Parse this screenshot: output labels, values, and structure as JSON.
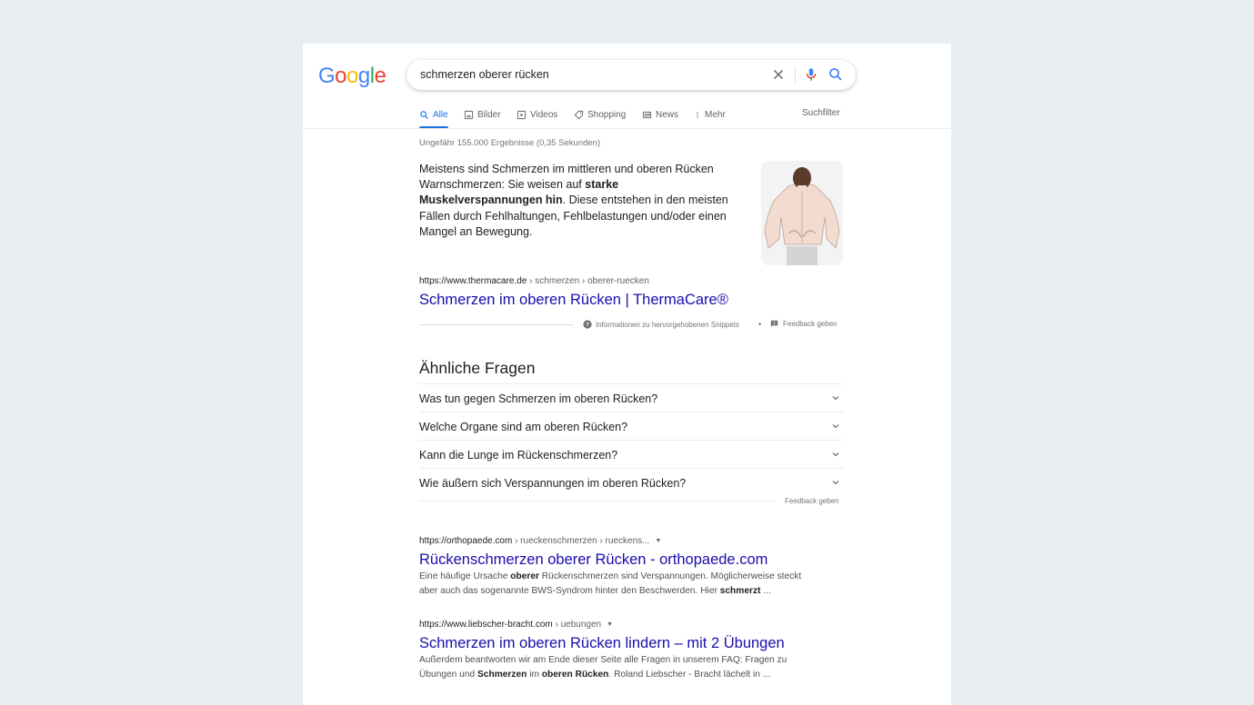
{
  "logo": {
    "letters": [
      "G",
      "o",
      "o",
      "g",
      "l",
      "e"
    ],
    "colors": [
      "#4285f4",
      "#ea4335",
      "#fbbc05",
      "#4285f4",
      "#34a853",
      "#ea4335"
    ]
  },
  "search": {
    "query": "schmerzen oberer rücken"
  },
  "tabs": [
    {
      "label": "Alle",
      "icon": "search-icon",
      "active": true
    },
    {
      "label": "Bilder",
      "icon": "image-icon"
    },
    {
      "label": "Videos",
      "icon": "video-icon"
    },
    {
      "label": "Shopping",
      "icon": "tag-icon"
    },
    {
      "label": "News",
      "icon": "news-icon"
    },
    {
      "label": "Mehr",
      "icon": "more-vert-icon"
    }
  ],
  "suchfilter": "Suchfilter",
  "stats": "Ungefähr 155.000 Ergebnisse (0,35 Sekunden)",
  "featured": {
    "text_1": "Meistens sind Schmerzen im mittleren und oberen Rücken Warnschmerzen: Sie weisen auf ",
    "text_bold": "starke Muskelverspannungen hin",
    "text_2": ". Diese entstehen in den meisten Fällen durch Fehlhaltungen, Fehlbelastungen und/oder einen Mangel an Bewegung.",
    "cite_domain": "https://www.thermacare.de",
    "cite_path": " › schmerzen › oberer-ruecken",
    "title": "Schmerzen im oberen Rücken | ThermaCare®",
    "info_label": "Informationen zu hervorgehobenen Snippets",
    "dot": "•",
    "feedback": "Feedback geben"
  },
  "paa": {
    "heading": "Ähnliche Fragen",
    "questions": [
      "Was tun gegen Schmerzen im oberen Rücken?",
      "Welche Organe sind am oberen Rücken?",
      "Kann die Lunge im Rückenschmerzen?",
      "Wie äußern sich Verspannungen im oberen Rücken?"
    ],
    "feedback": "Feedback geben"
  },
  "results": [
    {
      "cite_domain": "https://orthopaede.com",
      "cite_path": " › rueckenschmerzen › rueckens...",
      "title": "Rückenschmerzen oberer Rücken - orthopaede.com",
      "desc_parts": [
        {
          "t": "Eine häufige Ursache "
        },
        {
          "t": "oberer",
          "b": true
        },
        {
          "t": " Rückenschmerzen sind Verspannungen. Möglicherweise steckt aber auch das sogenannte BWS-Syndrom hinter den Beschwerden. Hier "
        },
        {
          "t": "schmerzt",
          "b": true
        },
        {
          "t": " ..."
        }
      ]
    },
    {
      "cite_domain": "https://www.liebscher-bracht.com",
      "cite_path": " › uebungen",
      "title": "Schmerzen im oberen Rücken lindern – mit 2 Übungen",
      "desc_parts": [
        {
          "t": "Außerdem beantworten wir am Ende dieser Seite alle Fragen in unserem FAQ: Fragen zu Übungen und "
        },
        {
          "t": "Schmerzen",
          "b": true
        },
        {
          "t": " im "
        },
        {
          "t": "oberen Rücken",
          "b": true
        },
        {
          "t": ". Roland Liebscher - Bracht lächelt in ..."
        }
      ]
    }
  ]
}
